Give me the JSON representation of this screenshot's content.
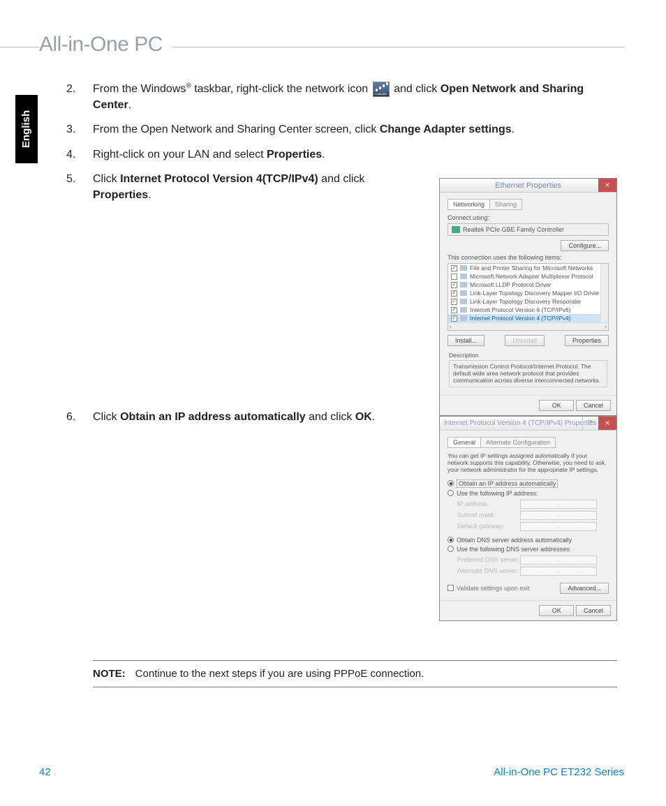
{
  "header": {
    "title": "All-in-One PC"
  },
  "lang_tab": "English",
  "steps": [
    {
      "n": "2.",
      "parts": [
        "From the Windows",
        "®",
        " taskbar, right-click the network icon ",
        "ICON",
        " and click ",
        "Open Network and Sharing Center",
        "."
      ]
    },
    {
      "n": "3.",
      "parts": [
        "From the Open Network and Sharing Center screen, click ",
        "Change Adapter settings",
        "."
      ]
    },
    {
      "n": "4.",
      "parts": [
        "Right-click on your LAN and select ",
        "Properties",
        "."
      ]
    },
    {
      "n": "5.",
      "parts": [
        "Click ",
        "Internet Protocol Version 4(TCP/IPv4)",
        " and click ",
        "Properties",
        "."
      ]
    },
    {
      "n": "6.",
      "parts": [
        "Click ",
        "Obtain an IP address automatically",
        " and click ",
        "OK",
        "."
      ]
    }
  ],
  "dlg1": {
    "title": "Ethernet Properties",
    "tabs": [
      "Networking",
      "Sharing"
    ],
    "connect_label": "Connect using:",
    "nic": "Realtek PCIe GBE Family Controller",
    "configure": "Configure...",
    "uses_label": "This connection uses the following items:",
    "items": [
      {
        "chk": true,
        "label": "File and Printer Sharing for Microsoft Networks"
      },
      {
        "chk": false,
        "label": "Microsoft Network Adapter Multiplexor Protocol"
      },
      {
        "chk": true,
        "label": "Microsoft LLDP Protocol Driver"
      },
      {
        "chk": true,
        "label": "Link-Layer Topology Discovery Mapper I/O Driver"
      },
      {
        "chk": true,
        "label": "Link-Layer Topology Discovery Responder"
      },
      {
        "chk": true,
        "label": "Internet Protocol Version 6 (TCP/IPv6)"
      },
      {
        "chk": true,
        "label": "Internet Protocol Version 4 (TCP/IPv4)",
        "selected": true
      }
    ],
    "buttons": {
      "install": "Install...",
      "uninstall": "Uninstall",
      "properties": "Properties"
    },
    "desc_label": "Description",
    "desc_text": "Transmission Control Protocol/Internet Protocol. The default wide area network protocol that provides communication across diverse interconnected networks.",
    "ok": "OK",
    "cancel": "Cancel"
  },
  "dlg2": {
    "title": "Internet Protocol Version 4 (TCP/IPv4) Properties",
    "tabs": [
      "General",
      "Alternate Configuration"
    ],
    "intro": "You can get IP settings assigned automatically if your network supports this capability. Otherwise, you need to ask your network administrator for the appropriate IP settings.",
    "opt_auto_ip": "Obtain an IP address automatically",
    "opt_manual_ip": "Use the following IP address:",
    "ip_labels": [
      "IP address:",
      "Subnet mask:",
      "Default gateway:"
    ],
    "opt_auto_dns": "Obtain DNS server address automatically",
    "opt_manual_dns": "Use the following DNS server addresses:",
    "dns_labels": [
      "Preferred DNS server:",
      "Alternate DNS server:"
    ],
    "validate": "Validate settings upon exit",
    "advanced": "Advanced...",
    "ok": "OK",
    "cancel": "Cancel"
  },
  "note": {
    "label": "NOTE:",
    "text": "Continue to the next steps if you are using PPPoE connection."
  },
  "footer": {
    "page": "42",
    "series": "All-in-One PC ET232 Series"
  }
}
